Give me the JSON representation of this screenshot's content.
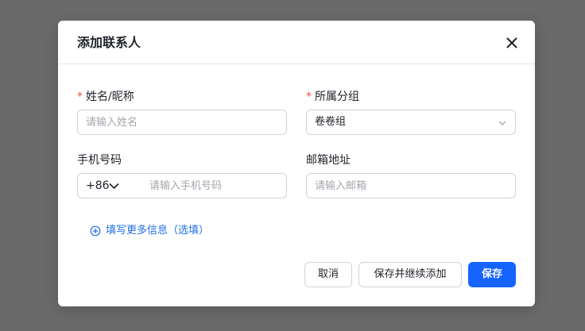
{
  "dialog": {
    "title": "添加联系人",
    "close_icon": "close-icon"
  },
  "form": {
    "name": {
      "required_mark": "*",
      "label": "姓名/昵称",
      "placeholder": "请输入姓名",
      "value": ""
    },
    "group": {
      "required_mark": "*",
      "label": "所属分组",
      "value": "卷卷组",
      "icon": "chevron-down-icon"
    },
    "phone": {
      "label": "手机号码",
      "country_code": "+86",
      "placeholder": "请输入手机号码",
      "value": "",
      "icon": "chevron-down-icon"
    },
    "email": {
      "label": "邮箱地址",
      "placeholder": "请输入邮箱",
      "value": ""
    },
    "more_link": {
      "icon": "plus-circle-icon",
      "label": "填写更多信息（选填）"
    }
  },
  "footer": {
    "cancel_label": "取消",
    "save_continue_label": "保存并继续添加",
    "save_label": "保存"
  },
  "colors": {
    "primary": "#1664ff",
    "link": "#1f6fe5",
    "required": "#f54a45",
    "overlay": "#6a6a6a"
  }
}
